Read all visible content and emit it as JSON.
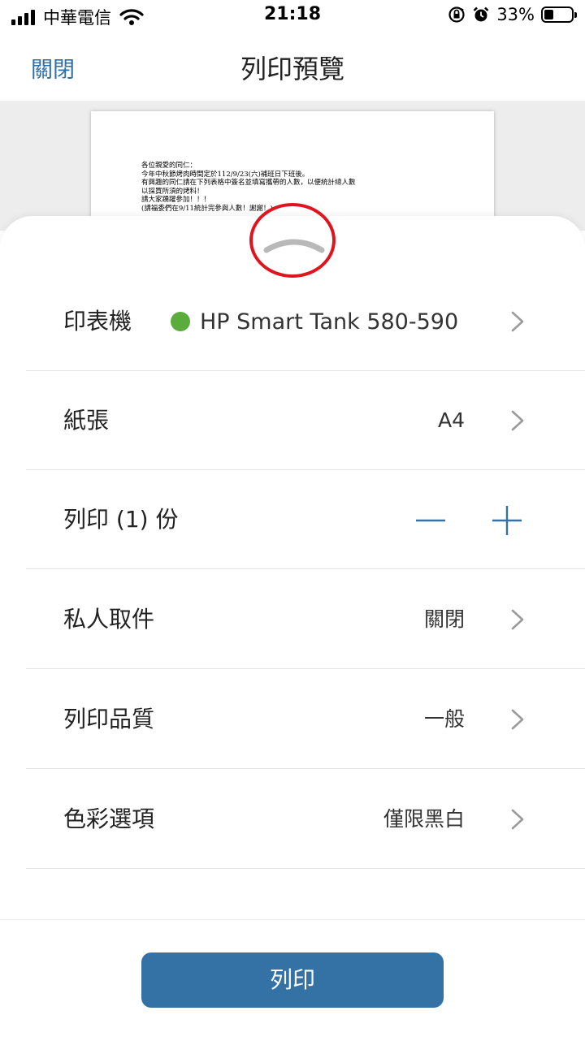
{
  "status_bar": {
    "carrier": "中華電信",
    "time": "21:18",
    "battery_percent": "33%",
    "battery_level": 0.33,
    "icons": [
      "signal-icon",
      "wifi-icon",
      "rotation-lock-icon",
      "alarm-icon",
      "battery-icon"
    ]
  },
  "nav": {
    "close_label": "關閉",
    "title": "列印預覽"
  },
  "preview": {
    "lines": [
      "各位親愛的同仁：",
      "今年中秋節烤肉時間定於112/9/23(六)補班日下班後。",
      "有興趣的同仁請在下列表格中簽名並填寫攜帶的人數，以便統計總人數",
      "以採買所須的烤料！",
      "請大家踴躍參加！！！",
      "(請福委們在9/11統計完參與人數！謝謝！)"
    ]
  },
  "settings": {
    "printer": {
      "label": "印表機",
      "value": "HP Smart Tank 580-590",
      "status_color": "#5aad3c"
    },
    "paper": {
      "label": "紙張",
      "value": "A4"
    },
    "copies": {
      "label": "列印 (1) 份",
      "count": 1
    },
    "private_pickup": {
      "label": "私人取件",
      "value": "關閉"
    },
    "quality": {
      "label": "列印品質",
      "value": "一般"
    },
    "color": {
      "label": "色彩選項",
      "value": "僅限黑白"
    }
  },
  "print_button": {
    "label": "列印"
  },
  "colors": {
    "accent": "#3472a6",
    "nav_link": "#2e6ea6",
    "highlight_circle": "#e0141e"
  }
}
